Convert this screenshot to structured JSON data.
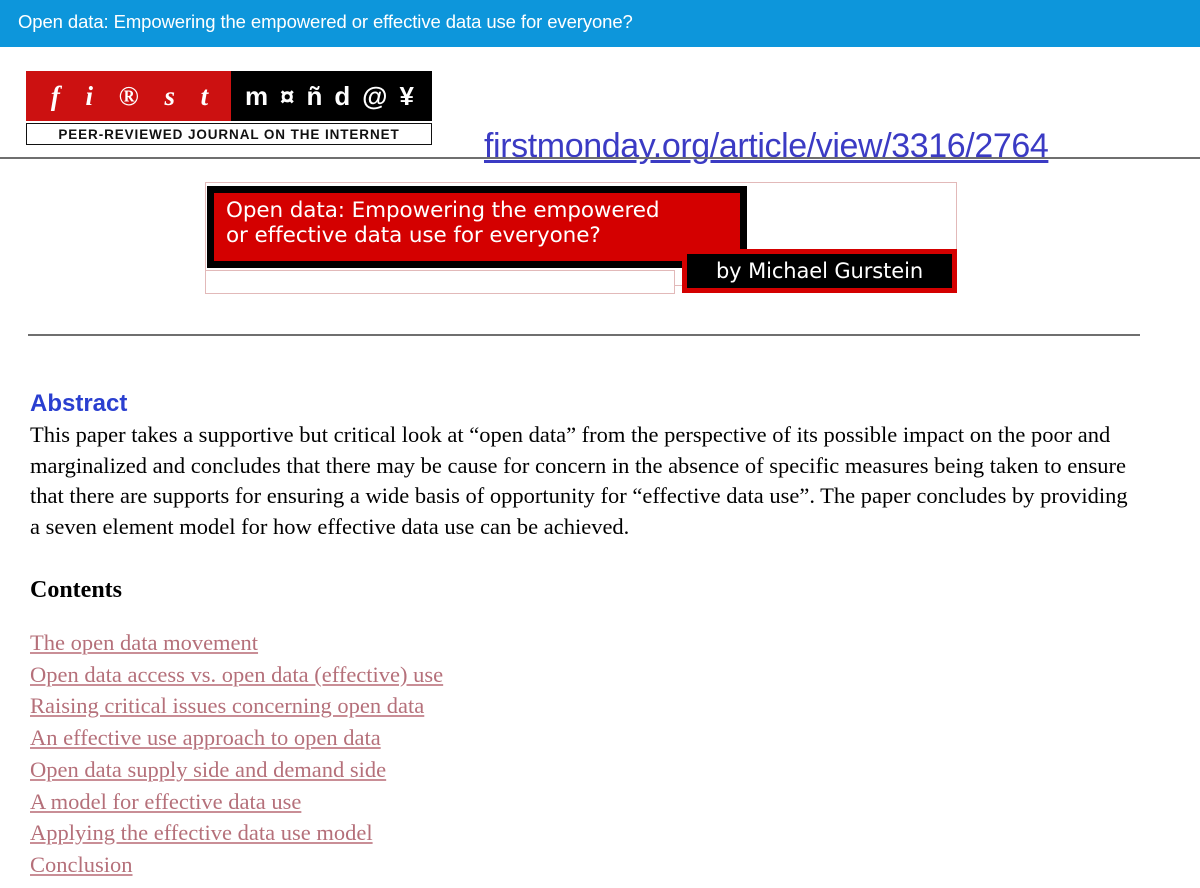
{
  "window": {
    "title": "Open data: Empowering the empowered or effective data use for everyone?"
  },
  "masthead": {
    "logo": {
      "name": "first-monday-logo",
      "red_glyphs": [
        "f",
        "i",
        "®",
        "s",
        "t"
      ],
      "black_glyphs": [
        "m",
        "¤",
        "ñ",
        "d",
        "@",
        "¥"
      ],
      "tagline": "PEER-REVIEWED JOURNAL ON THE INTERNET"
    },
    "url": "firstmonday.org/article/view/3316/2764"
  },
  "banner": {
    "title_line1": "Open data: Empowering the empowered",
    "title_line2": "or effective data use for everyone?",
    "author": "by Michael Gurstein",
    "colors": {
      "red": "#d40000",
      "black": "#000000",
      "outline": "#e2b9b9"
    }
  },
  "article": {
    "abstract_heading": "Abstract",
    "abstract_text": "This paper takes a supportive but critical look at “open data” from the perspective of its possible impact on the poor and marginalized and concludes that there may be cause for concern in the absence of specific measures being taken to ensure that there are supports for ensuring a wide basis of opportunity for “effective data use”. The paper concludes by providing a seven element model for how effective data use can be achieved.",
    "contents_heading": "Contents",
    "contents": [
      "The open data movement",
      "Open data access vs. open data (effective) use",
      "Raising critical issues concerning open data",
      "An effective use approach to open data",
      "Open data supply side and demand side",
      "A model for effective data use",
      "Applying the effective data use model",
      "Conclusion"
    ]
  },
  "theme": {
    "header_bar": "#0d96db",
    "link_blue": "#3b3bc4",
    "abstract_blue": "#2a3fd0",
    "contents_link": "#b5707a",
    "rule": "#6f6f6f"
  }
}
